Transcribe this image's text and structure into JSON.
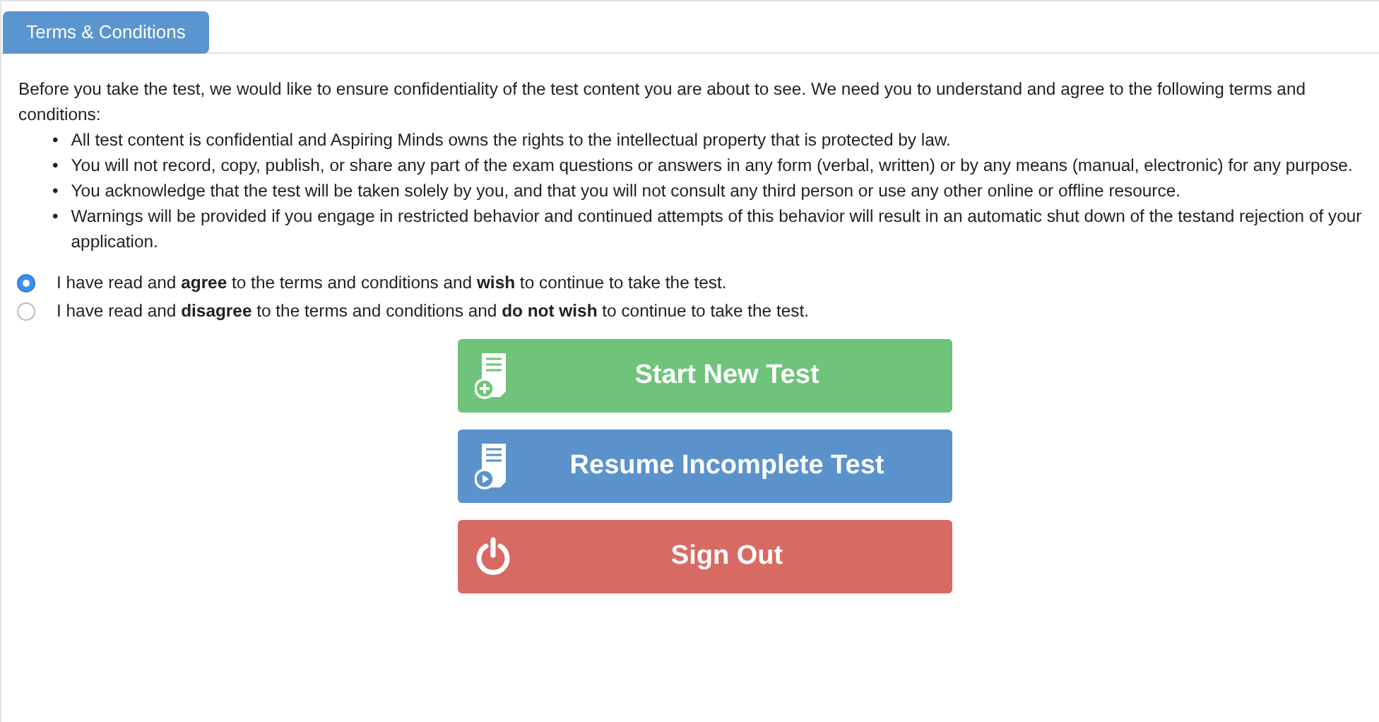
{
  "tab": {
    "label": "Terms & Conditions",
    "selected": true
  },
  "intro": "Before you take the test, we would like to ensure confidentiality of the test content you are about to see. We need you to understand and agree to the following terms and conditions:",
  "bullet": "•",
  "terms": [
    "All test content is confidential and Aspiring Minds owns the rights to the intellectual property that is protected by law.",
    "You will not record, copy, publish, or share any part of the exam questions or answers in any form (verbal, written) or by any means (manual, electronic) for any purpose.",
    "You acknowledge that the test will be taken solely by you, and that you will not consult any third person or use any other online or offline resource.",
    "Warnings will be provided if you engage in restricted behavior and continued attempts of this behavior will result in an automatic shut down of the testand rejection of your application."
  ],
  "options": [
    {
      "label": "I have read and **agree** to the terms and conditions and **wish** to continue to take the test.",
      "selected": true
    },
    {
      "label": "I have read and **disagree** to the terms and conditions and **do not wish** to continue to take the test.",
      "selected": false
    }
  ],
  "buttons": [
    {
      "kind": "new",
      "label": "Start New Test"
    },
    {
      "kind": "resume",
      "label": "Resume Incomplete Test"
    },
    {
      "kind": "signout",
      "label": "Sign Out"
    }
  ]
}
